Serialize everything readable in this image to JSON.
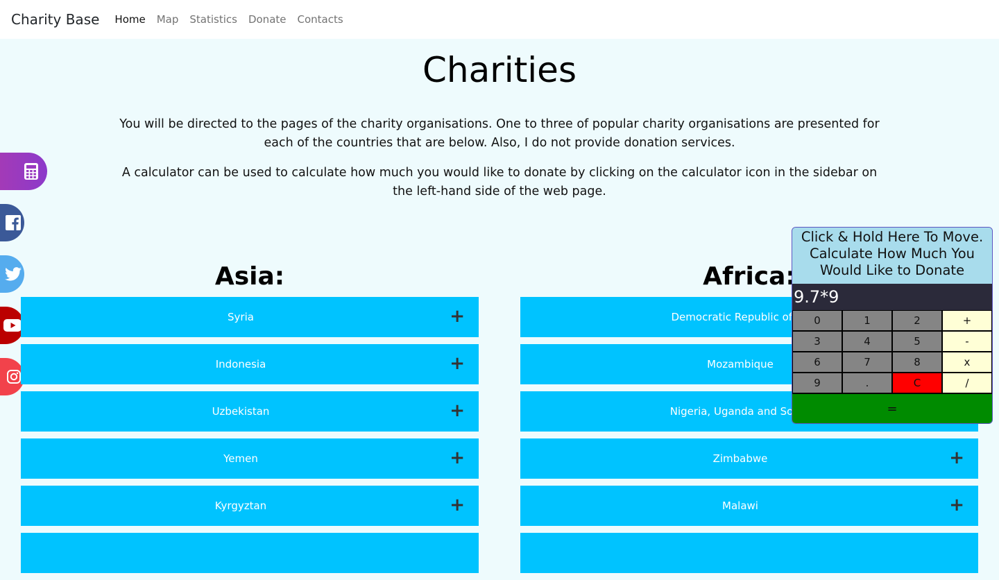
{
  "navbar": {
    "brand": "Charity Base",
    "links": [
      "Home",
      "Map",
      "Statistics",
      "Donate",
      "Contacts"
    ]
  },
  "main": {
    "title": "Charities",
    "intro_1": "You will be directed to the pages of the charity organisations. One to three of popular charity organisations are presented for each of the countries that are below. Also, I do not provide donation services.",
    "intro_2": "A calculator can be used to calculate how much you would like to donate by clicking on the calculator icon in the sidebar on the left-hand side of the web page."
  },
  "sidebar": {
    "icons": [
      "calculator-icon",
      "facebook-icon",
      "twitter-icon",
      "youtube-icon",
      "instagram-icon"
    ]
  },
  "regions": {
    "asia": {
      "heading": "Asia:",
      "items": [
        "Syria",
        "Indonesia",
        "Uzbekistan",
        "Yemen",
        "Kyrgyztan"
      ]
    },
    "africa": {
      "heading": "Africa:",
      "items": [
        "Democratic Republic of Co",
        "Mozambique",
        "Nigeria, Uganda and South",
        "Zimbabwe",
        "Malawi"
      ]
    },
    "expand_symbol": "+"
  },
  "calculator": {
    "header": "Click & Hold Here To Move. Calculate How Much You Would Like to Donate",
    "display": "9.7*9",
    "keys": [
      "0",
      "1",
      "2",
      "+",
      "3",
      "4",
      "5",
      "-",
      "6",
      "7",
      "8",
      "x",
      "9",
      ".",
      "C",
      "/"
    ],
    "equals": "="
  },
  "colors": {
    "page_bg": "#eefbfd",
    "accordion_bg": "#00c3ff",
    "calc_header_bg": "#a8dcec",
    "calc_display_bg": "#2b2a3a",
    "calc_num_key": "#858585",
    "calc_op_key": "#ffffd6",
    "calc_clear_key": "#ff0000",
    "calc_equals": "#008b00"
  }
}
